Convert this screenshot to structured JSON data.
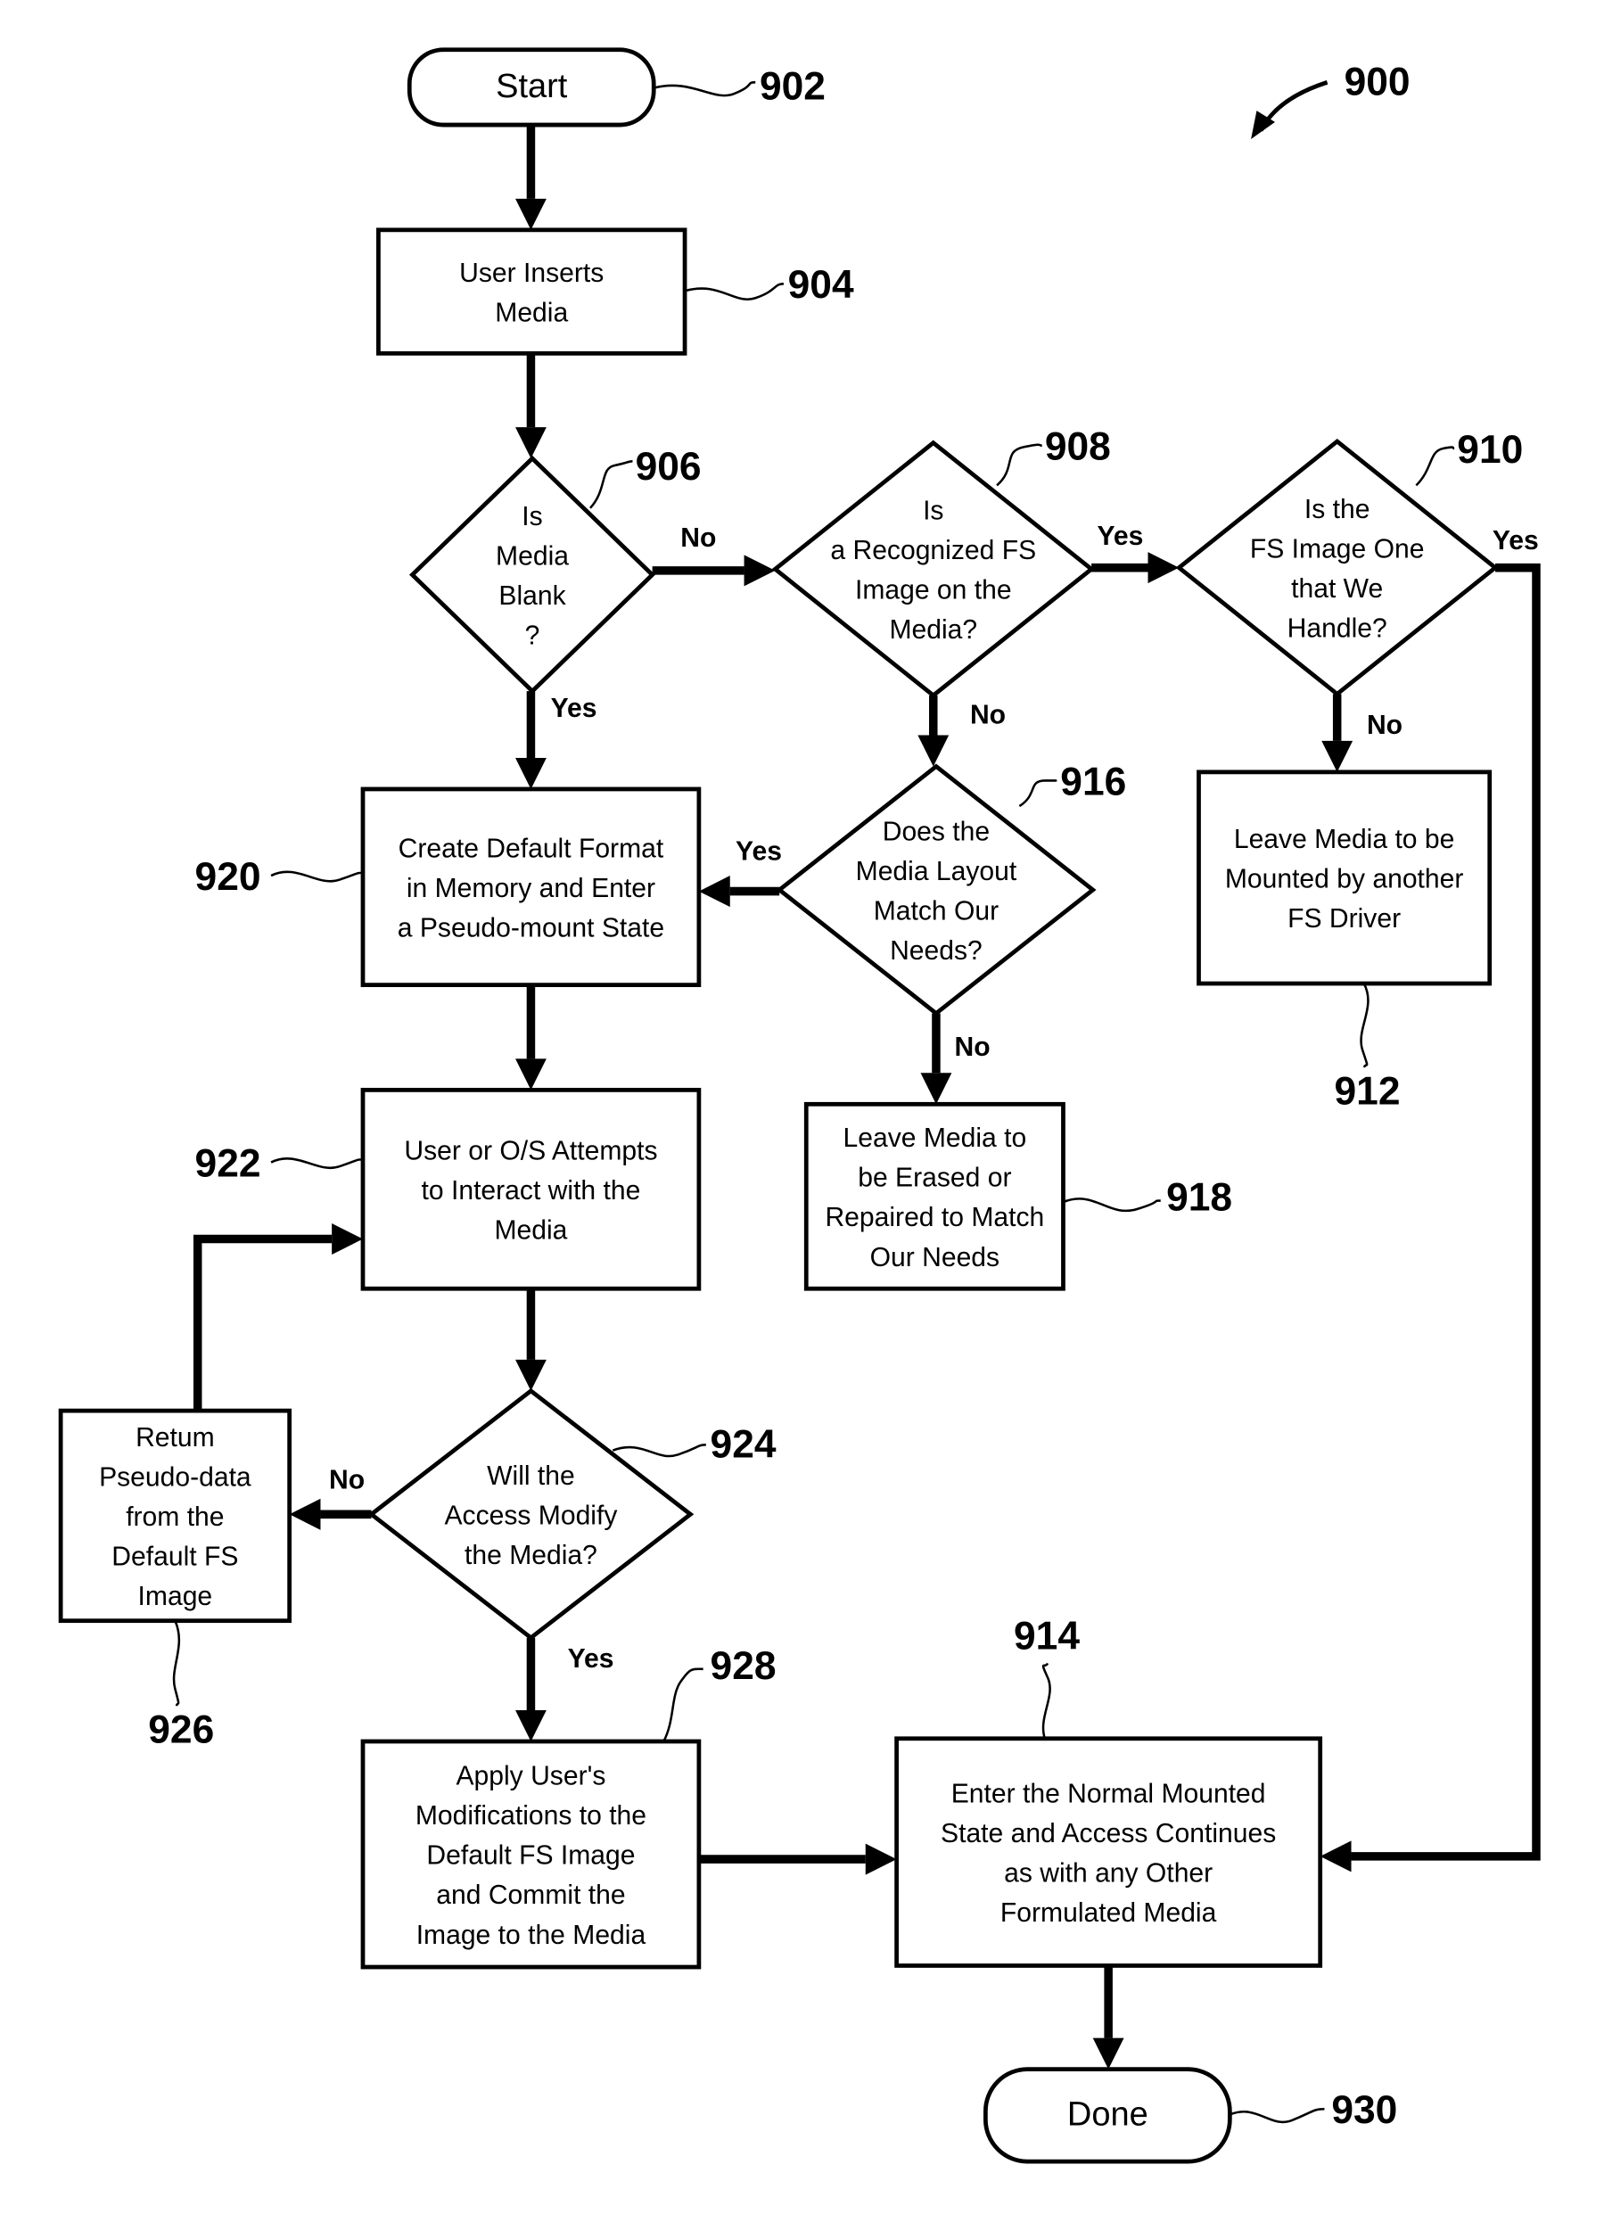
{
  "figure": {
    "reference": "900",
    "nodes": [
      {
        "id": "902",
        "type": "terminal",
        "lines": [
          "Start"
        ]
      },
      {
        "id": "904",
        "type": "process",
        "lines": [
          "User Inserts",
          "Media"
        ]
      },
      {
        "id": "906",
        "type": "decision",
        "lines": [
          "Is",
          "Media",
          "Blank",
          "?"
        ]
      },
      {
        "id": "908",
        "type": "decision",
        "lines": [
          "Is",
          "a Recognized FS",
          "Image on the",
          "Media?"
        ]
      },
      {
        "id": "910",
        "type": "decision",
        "lines": [
          "Is the",
          "FS Image One",
          "that We",
          "Handle?"
        ]
      },
      {
        "id": "912",
        "type": "process",
        "lines": [
          "Leave Media to be",
          "Mounted by another",
          "FS Driver"
        ]
      },
      {
        "id": "916",
        "type": "decision",
        "lines": [
          "Does the",
          "Media Layout",
          "Match Our",
          "Needs?"
        ]
      },
      {
        "id": "918",
        "type": "process",
        "lines": [
          "Leave Media to",
          "be Erased or",
          "Repaired to Match",
          "Our Needs"
        ]
      },
      {
        "id": "920",
        "type": "process",
        "lines": [
          "Create Default Format",
          "in Memory and Enter",
          "a Pseudo-mount State"
        ]
      },
      {
        "id": "922",
        "type": "process",
        "lines": [
          "User or O/S Attempts",
          "to Interact with the",
          "Media"
        ]
      },
      {
        "id": "924",
        "type": "decision",
        "lines": [
          "Will the",
          "Access Modify",
          "the Media?"
        ]
      },
      {
        "id": "926",
        "type": "process",
        "lines": [
          "Retum",
          "Pseudo-data",
          "from the",
          "Default FS",
          "Image"
        ]
      },
      {
        "id": "928",
        "type": "process",
        "lines": [
          "Apply User's",
          "Modifications to the",
          "Default FS Image",
          "and Commit the",
          "Image to the Media"
        ]
      },
      {
        "id": "914",
        "type": "process",
        "lines": [
          "Enter the Normal Mounted",
          "State and Access Continues",
          "as with any Other",
          "Formulated Media"
        ]
      },
      {
        "id": "930",
        "type": "terminal",
        "lines": [
          "Done"
        ]
      }
    ],
    "branch_labels": {
      "906_no": "No",
      "906_yes": "Yes",
      "908_yes": "Yes",
      "908_no": "No",
      "910_yes": "Yes",
      "910_no": "No",
      "916_yes": "Yes",
      "916_no": "No",
      "924_no": "No",
      "924_yes": "Yes"
    },
    "edges": [
      {
        "from": "902",
        "to": "904"
      },
      {
        "from": "904",
        "to": "906"
      },
      {
        "from": "906",
        "to": "908",
        "label": "No"
      },
      {
        "from": "906",
        "to": "920",
        "label": "Yes"
      },
      {
        "from": "908",
        "to": "910",
        "label": "Yes"
      },
      {
        "from": "908",
        "to": "916",
        "label": "No"
      },
      {
        "from": "910",
        "to": "912",
        "label": "No"
      },
      {
        "from": "910",
        "to": "914",
        "label": "Yes"
      },
      {
        "from": "916",
        "to": "920",
        "label": "Yes"
      },
      {
        "from": "916",
        "to": "918",
        "label": "No"
      },
      {
        "from": "920",
        "to": "922"
      },
      {
        "from": "922",
        "to": "924"
      },
      {
        "from": "924",
        "to": "926",
        "label": "No"
      },
      {
        "from": "926",
        "to": "922"
      },
      {
        "from": "924",
        "to": "928",
        "label": "Yes"
      },
      {
        "from": "928",
        "to": "914"
      },
      {
        "from": "914",
        "to": "930"
      }
    ]
  }
}
